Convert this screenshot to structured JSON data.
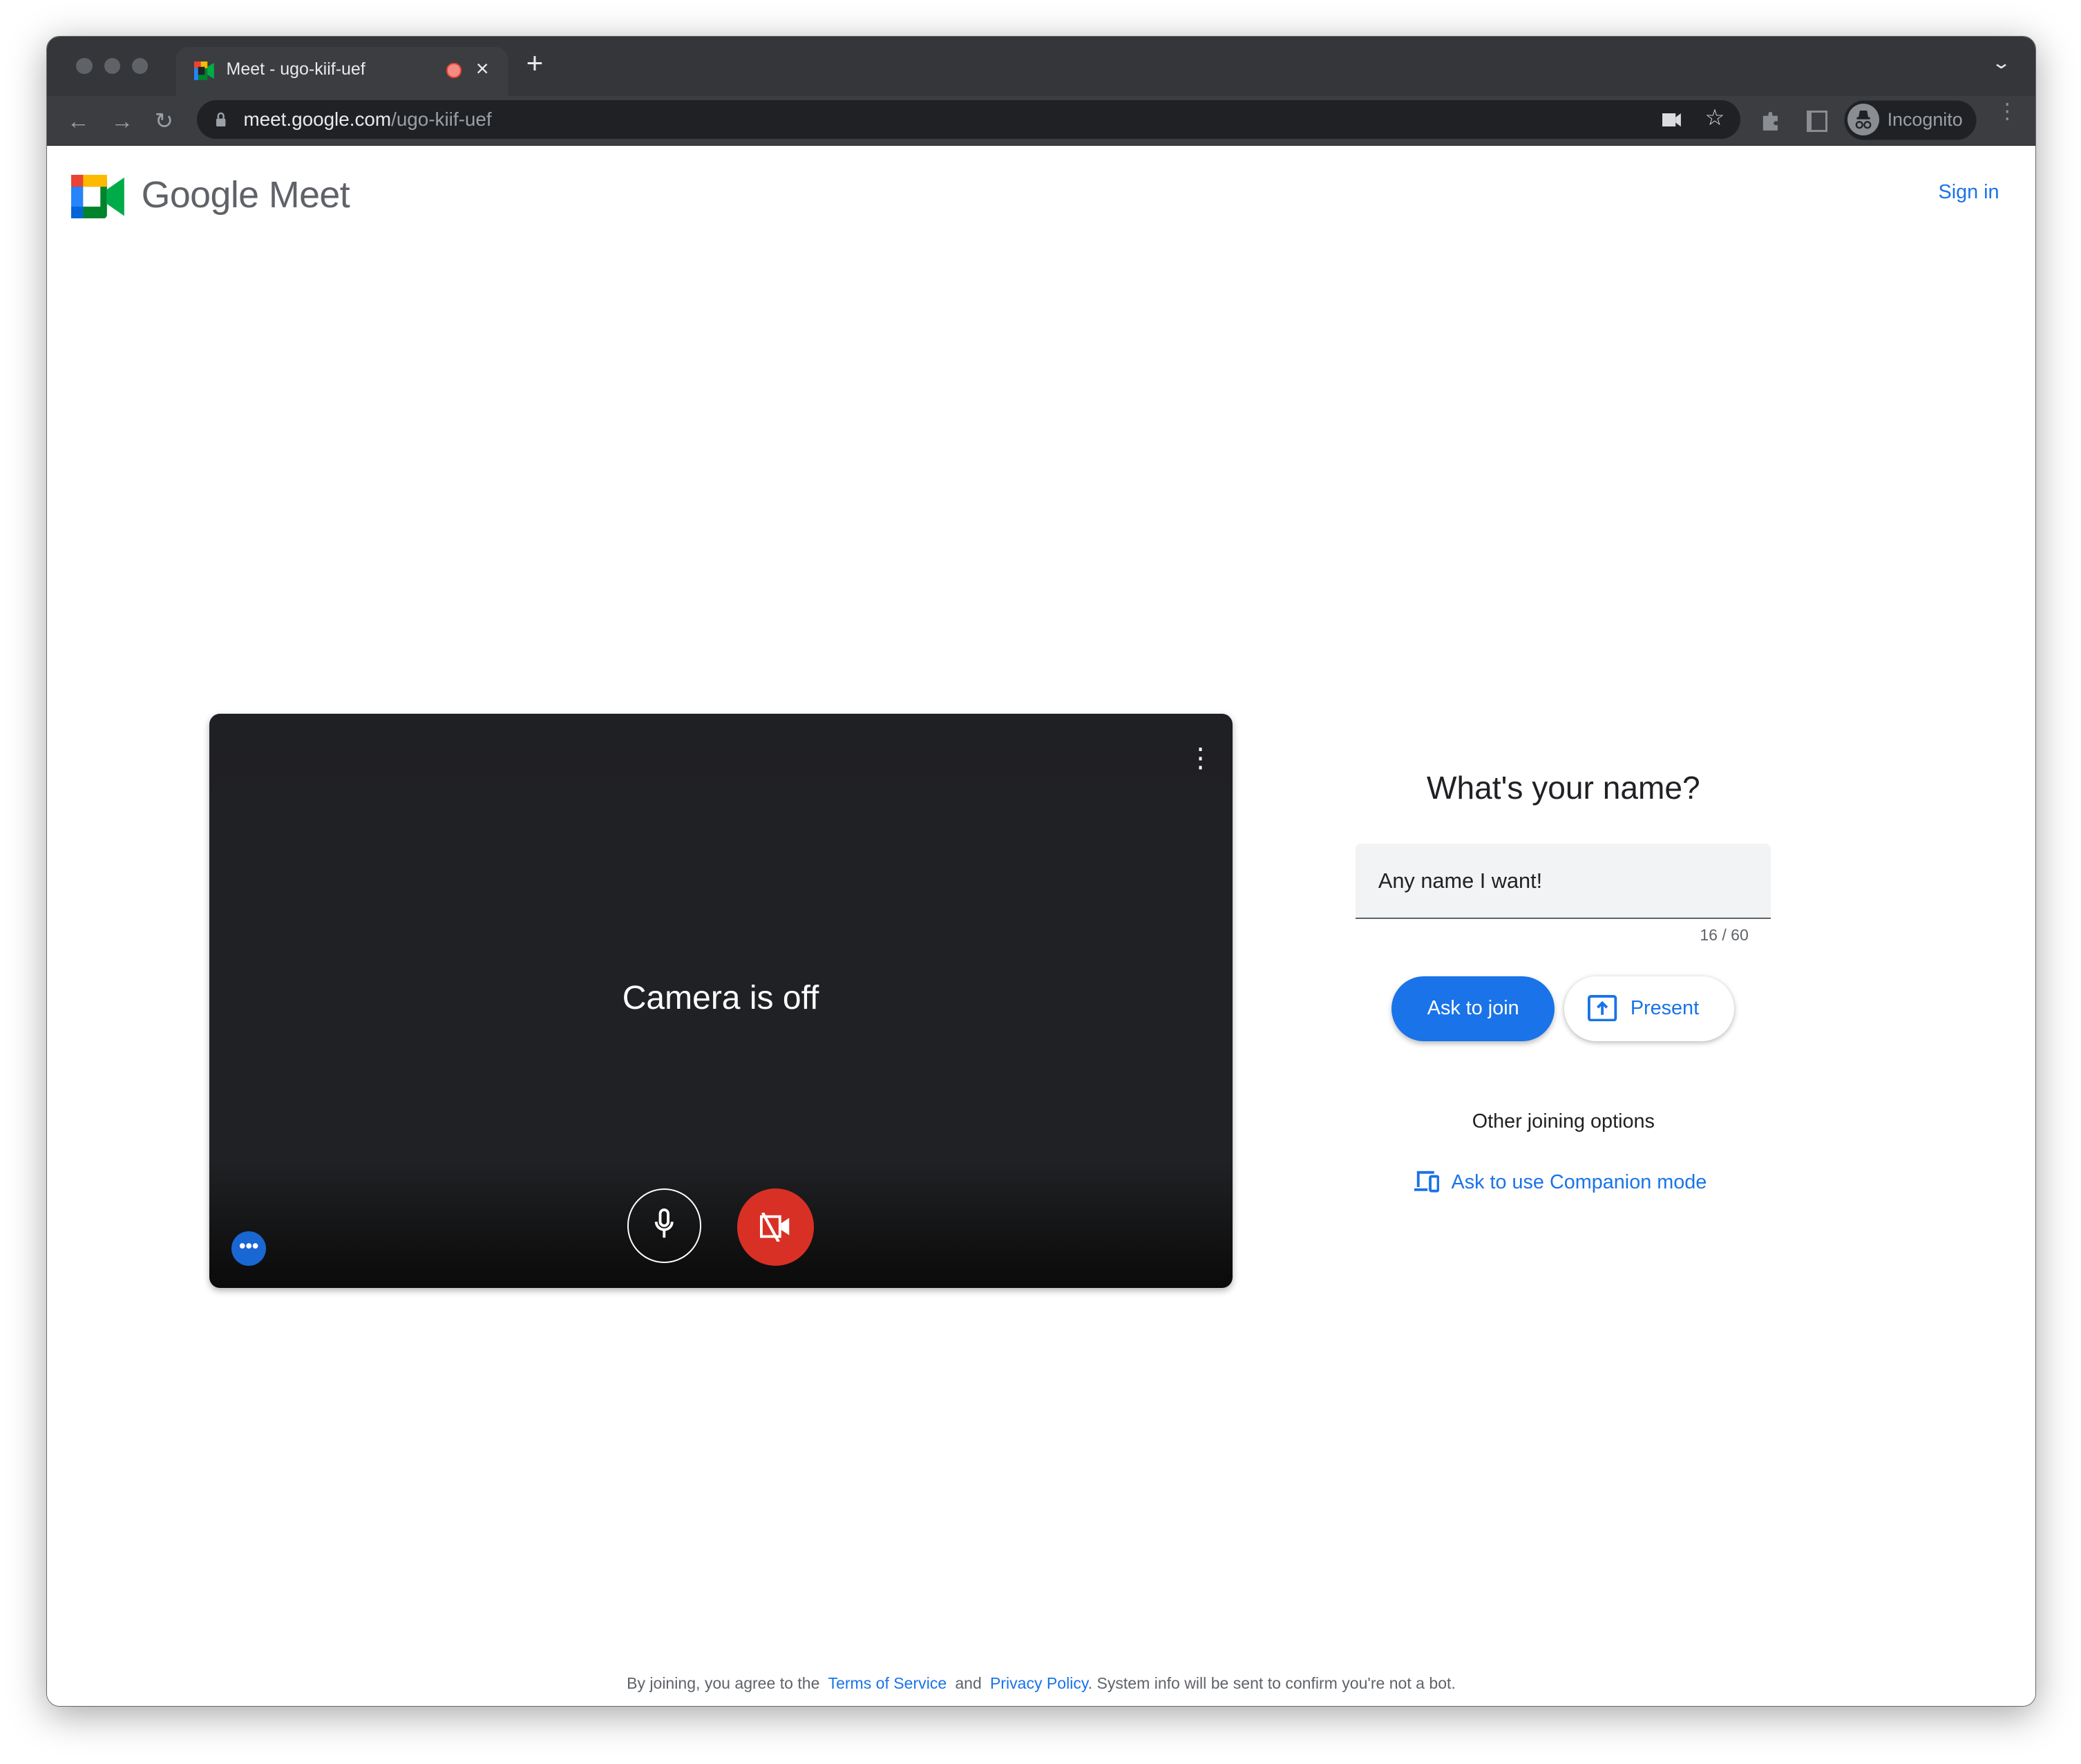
{
  "browser": {
    "tab_title": "Meet - ugo-kiif-uef",
    "url_domain": "meet.google.com",
    "url_path": "/ugo-kiif-uef",
    "profile_label": "Incognito"
  },
  "header": {
    "logo_text": "Google Meet",
    "sign_in": "Sign in"
  },
  "preview": {
    "camera_status": "Camera is off"
  },
  "join": {
    "heading": "What's your name?",
    "name_value": "Any name I want!",
    "char_counter": "16 / 60",
    "ask_to_join": "Ask to join",
    "present": "Present",
    "other_options_heading": "Other joining options",
    "companion_mode": "Ask to use Companion mode"
  },
  "footer": {
    "prefix": "By joining, you agree to the",
    "terms": "Terms of Service",
    "and": "and",
    "privacy": "Privacy Policy",
    "suffix": ". System info will be sent to confirm you're not a bot."
  },
  "colors": {
    "accent": "#1a73e8",
    "danger": "#d93025",
    "video_bg": "#202124",
    "chrome_dark": "#35363a"
  }
}
